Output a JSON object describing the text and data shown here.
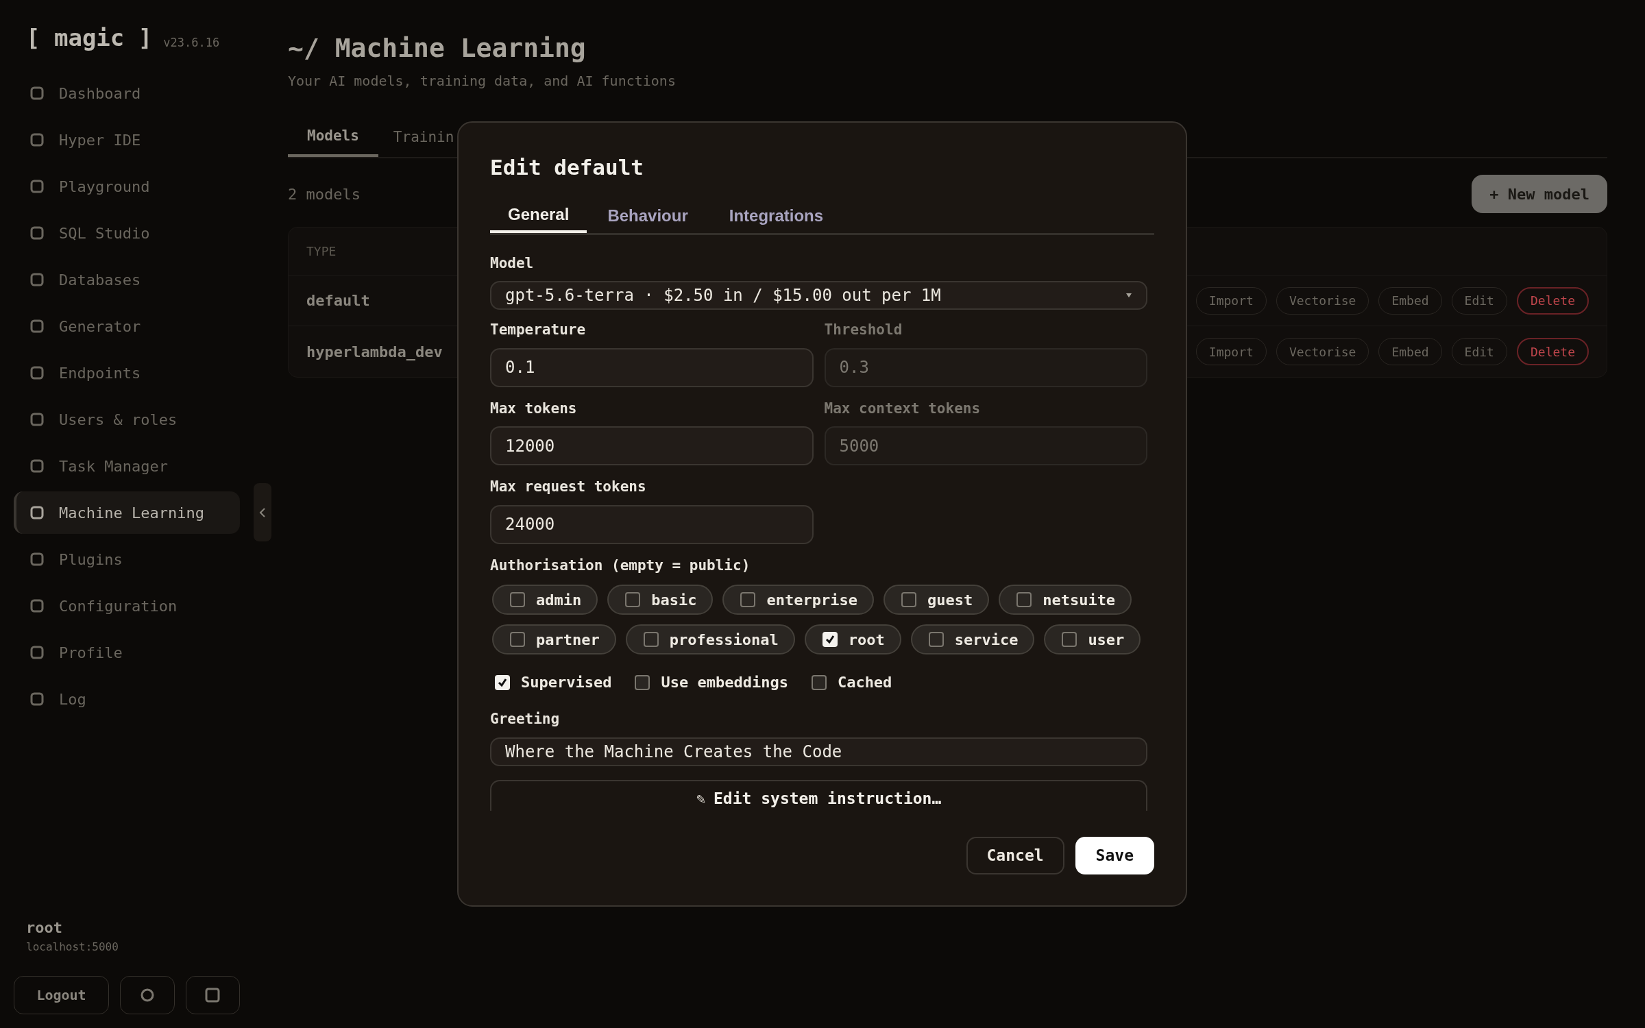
{
  "sidebar": {
    "logo": "[ magic ]",
    "version": "v23.6.16",
    "items": [
      {
        "label": "Dashboard",
        "selected": false
      },
      {
        "label": "Hyper IDE",
        "selected": false
      },
      {
        "label": "Playground",
        "selected": false
      },
      {
        "label": "SQL Studio",
        "selected": false
      },
      {
        "label": "Databases",
        "selected": false
      },
      {
        "label": "Generator",
        "selected": false
      },
      {
        "label": "Endpoints",
        "selected": false
      },
      {
        "label": "Users & roles",
        "selected": false
      },
      {
        "label": "Task Manager",
        "selected": false
      },
      {
        "label": "Machine Learning",
        "selected": true
      },
      {
        "label": "Plugins",
        "selected": false
      },
      {
        "label": "Configuration",
        "selected": false
      },
      {
        "label": "Profile",
        "selected": false
      },
      {
        "label": "Log",
        "selected": false
      }
    ],
    "user": "root",
    "host": "localhost:5000",
    "logout": "Logout"
  },
  "page": {
    "title": "~/ Machine Learning",
    "subtitle": "Your AI models, training data, and AI functions",
    "tabs": [
      {
        "label": "Models",
        "selected": true
      },
      {
        "label": "Trainin",
        "selected": false
      }
    ],
    "count": "2 models",
    "new_button": "+ New model",
    "table": {
      "columns": [
        "TYPE"
      ],
      "rows": [
        {
          "name": "default",
          "actions": [
            {
              "label": "Import",
              "kind": "normal"
            },
            {
              "label": "Vectorise",
              "kind": "normal"
            },
            {
              "label": "Embed",
              "kind": "normal"
            },
            {
              "label": "Edit",
              "kind": "normal"
            },
            {
              "label": "Delete",
              "kind": "danger"
            }
          ]
        },
        {
          "name": "hyperlambda_dev",
          "actions": [
            {
              "label": "Import",
              "kind": "normal"
            },
            {
              "label": "Vectorise",
              "kind": "normal"
            },
            {
              "label": "Embed",
              "kind": "normal"
            },
            {
              "label": "Edit",
              "kind": "normal"
            },
            {
              "label": "Delete",
              "kind": "danger"
            }
          ]
        }
      ]
    }
  },
  "dialog": {
    "title": "Edit default",
    "tabs": [
      {
        "label": "General",
        "selected": true
      },
      {
        "label": "Behaviour",
        "selected": false
      },
      {
        "label": "Integrations",
        "selected": false
      }
    ],
    "model": {
      "label": "Model",
      "value": "gpt-5.6-terra · $2.50 in / $15.00 out per 1M"
    },
    "fields": [
      {
        "label": "Temperature",
        "value": "0.1",
        "disabled": false
      },
      {
        "label": "Threshold",
        "value": "0.3",
        "disabled": true
      },
      {
        "label": "Max tokens",
        "value": "12000",
        "disabled": false
      },
      {
        "label": "Max context tokens",
        "value": "5000",
        "disabled": true
      },
      {
        "label": "Max request tokens",
        "value": "24000",
        "disabled": false
      }
    ],
    "roles_label": "Authorisation (empty = public)",
    "roles": [
      {
        "label": "admin",
        "checked": false
      },
      {
        "label": "basic",
        "checked": false
      },
      {
        "label": "enterprise",
        "checked": false
      },
      {
        "label": "guest",
        "checked": false
      },
      {
        "label": "netsuite",
        "checked": false
      },
      {
        "label": "partner",
        "checked": false
      },
      {
        "label": "professional",
        "checked": false
      },
      {
        "label": "root",
        "checked": true
      },
      {
        "label": "service",
        "checked": false
      },
      {
        "label": "user",
        "checked": false
      }
    ],
    "options": [
      {
        "label": "Supervised",
        "checked": true
      },
      {
        "label": "Use embeddings",
        "checked": false
      },
      {
        "label": "Cached",
        "checked": false
      }
    ],
    "greeting": {
      "label": "Greeting",
      "value": "Where the Machine Creates the Code"
    },
    "instruction_button": {
      "icon": "✎",
      "label": "Edit system instruction…"
    },
    "buttons": [
      {
        "label": "Cancel",
        "kind": "secondary"
      },
      {
        "label": "Save",
        "kind": "primary"
      }
    ]
  }
}
